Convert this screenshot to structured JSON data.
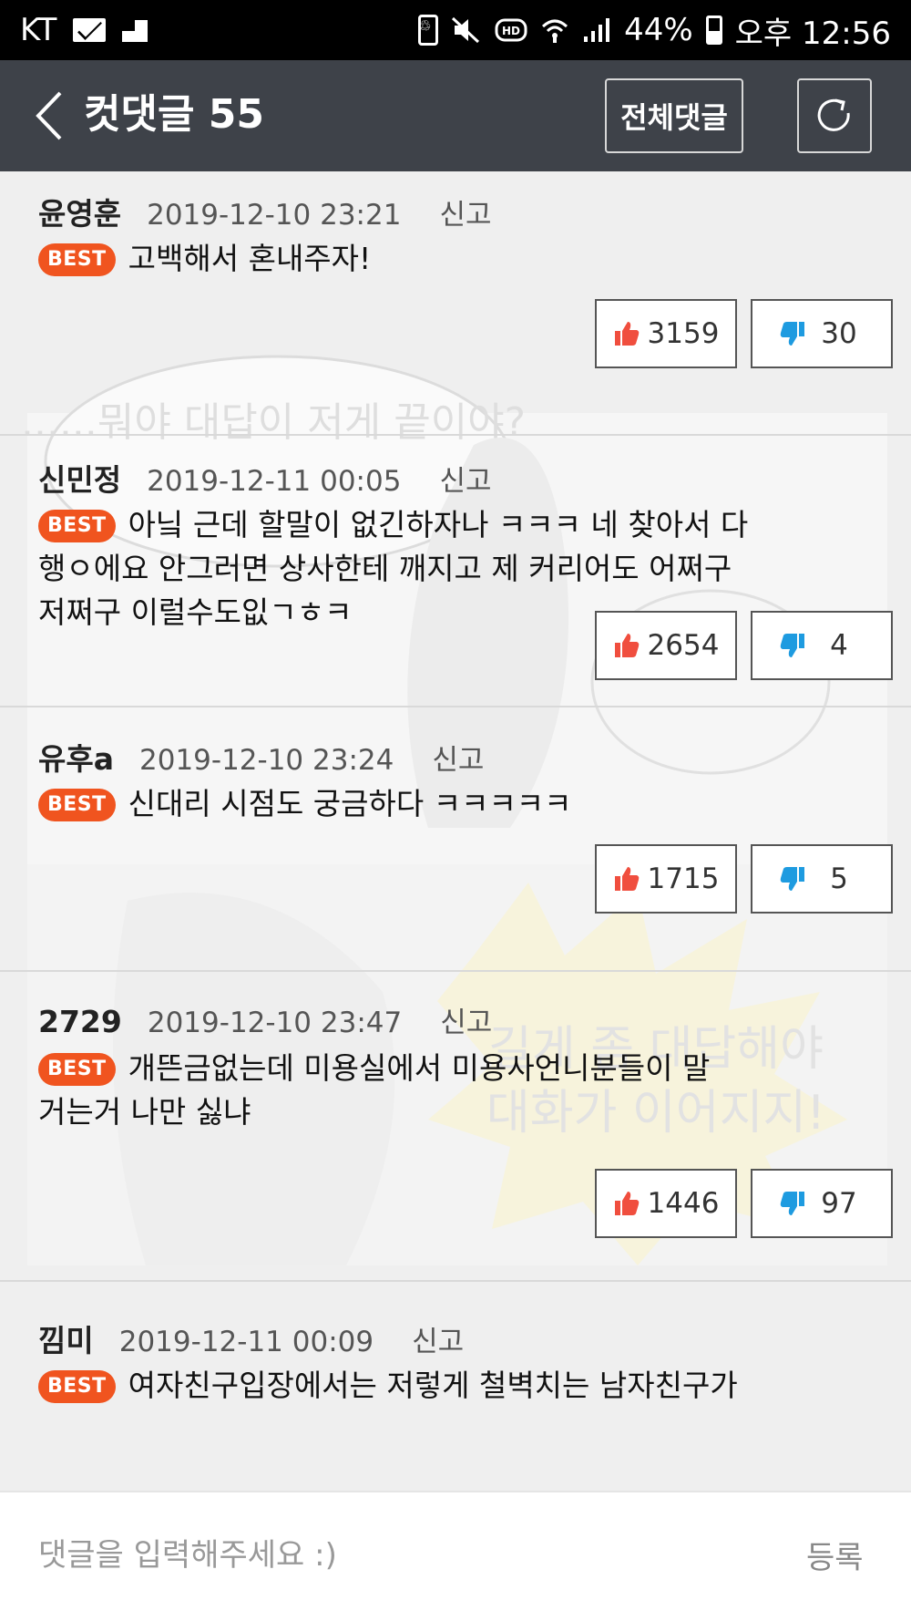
{
  "status_bar": {
    "carrier": "KT",
    "battery_percent": "44%",
    "time": "오후 12:56",
    "icons": [
      "mail-icon",
      "stairs-icon",
      "battery-saver-icon",
      "mute-icon",
      "hd-icon",
      "wifi-icon",
      "signal-icon",
      "battery-icon"
    ]
  },
  "header": {
    "title": "컷댓글 55",
    "all_comments_label": "전체댓글",
    "back_icon": "chevron-left-icon",
    "refresh_icon": "refresh-icon"
  },
  "comments": [
    {
      "author": "윤영훈",
      "date": "2019-12-10 23:21",
      "report_label": "신고",
      "badge": "BEST",
      "text": "고백해서 혼내주자!",
      "likes": "3159",
      "dislikes": "30"
    },
    {
      "author": "신민정",
      "date": "2019-12-11 00:05",
      "report_label": "신고",
      "badge": "BEST",
      "text": "아닠 근데 할말이 없긴하자나 ㅋㅋㅋ 네 찾아서 다행ㅇ에요 안그러면 상사한테 깨지고 제 커리어도 어쩌구저쩌구 이럴수도잆ㄱㅎㅋ",
      "likes": "2654",
      "dislikes": "4"
    },
    {
      "author": "유후a",
      "date": "2019-12-10 23:24",
      "report_label": "신고",
      "badge": "BEST",
      "text": "신대리 시점도 궁금하다 ㅋㅋㅋㅋㅋ",
      "likes": "1715",
      "dislikes": "5"
    },
    {
      "author": "2729",
      "date": "2019-12-10 23:47",
      "report_label": "신고",
      "badge": "BEST",
      "text": "개뜬금없는데 미용실에서 미용사언니분들이 말거는거 나만 싫냐",
      "likes": "1446",
      "dislikes": "97"
    },
    {
      "author": "낌미",
      "date": "2019-12-11 00:09",
      "report_label": "신고",
      "badge": "BEST",
      "text": "여자친구입장에서는 저렇게 철벽치는 남자친구가",
      "likes": "",
      "dislikes": ""
    }
  ],
  "background_art": {
    "bubble_1": "......뭐야 대답이 저게 끝이야?",
    "bubble_2": "길게 좀 대답해야 대화가 이어지지!"
  },
  "input_bar": {
    "placeholder": "댓글을 입력해주세요 :)",
    "submit_label": "등록"
  }
}
